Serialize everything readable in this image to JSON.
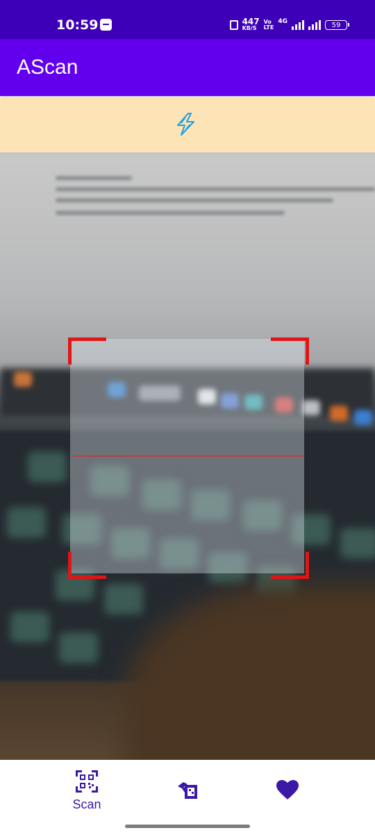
{
  "status_bar": {
    "time": "10:59",
    "speed_value": "447",
    "speed_unit": "KB/S",
    "volte_top": "Vo",
    "volte_bottom": "LTE",
    "network": "4G",
    "battery": "59"
  },
  "app_bar": {
    "title": "AScan"
  },
  "bottom_nav": {
    "items": [
      {
        "label": "Scan",
        "icon": "qr-code-icon",
        "selected": true
      },
      {
        "label": "",
        "icon": "create-qr-icon",
        "selected": false
      },
      {
        "label": "",
        "icon": "heart-icon",
        "selected": false
      }
    ]
  },
  "colors": {
    "status_bar": "#3d00b8",
    "app_bar": "#6200ee",
    "flash_bar": "#fde4b6",
    "scan_corners": "#e01515",
    "nav_icon": "#3b18a5"
  }
}
